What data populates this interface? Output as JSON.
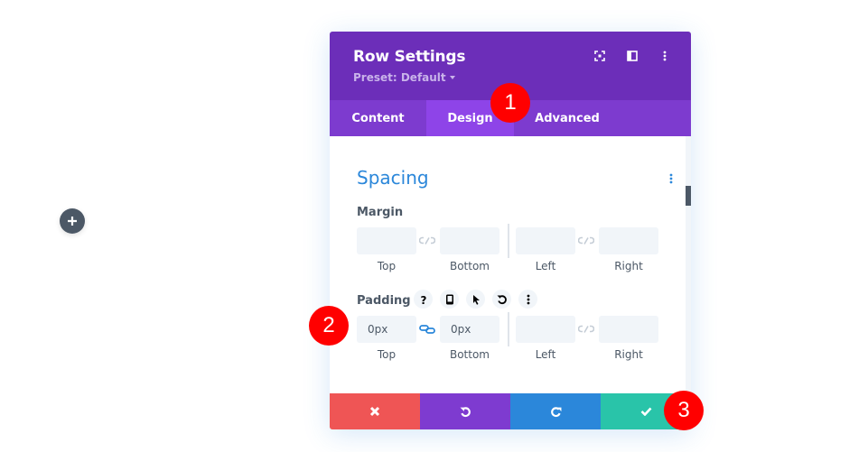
{
  "canvas": {
    "add_button_icon": "plus-icon"
  },
  "modal": {
    "title": "Row Settings",
    "preset_label": "Preset: Default",
    "header_icons": [
      "fullscreen-icon",
      "sidebar-toggle-icon",
      "more-vertical-icon"
    ],
    "tabs": [
      {
        "label": "Content",
        "active": false
      },
      {
        "label": "Design",
        "active": true
      },
      {
        "label": "Advanced",
        "active": false
      }
    ],
    "section": {
      "title": "Spacing",
      "margin": {
        "label": "Margin",
        "top": {
          "value": "",
          "label": "Top"
        },
        "bottom": {
          "value": "",
          "label": "Bottom"
        },
        "left": {
          "value": "",
          "label": "Left"
        },
        "right": {
          "value": "",
          "label": "Right"
        },
        "linked_vertical": false,
        "linked_horizontal": false
      },
      "padding": {
        "label": "Padding",
        "option_icons": [
          "help-icon",
          "mobile-icon",
          "cursor-icon",
          "reset-icon",
          "more-vertical-icon"
        ],
        "top": {
          "value": "0px",
          "label": "Top"
        },
        "bottom": {
          "value": "0px",
          "label": "Bottom"
        },
        "left": {
          "value": "",
          "label": "Left"
        },
        "right": {
          "value": "",
          "label": "Right"
        },
        "linked_vertical": true,
        "linked_horizontal": false
      }
    },
    "footer": {
      "cancel_icon": "close-icon",
      "undo_icon": "undo-icon",
      "redo_icon": "redo-icon",
      "save_icon": "checkmark-icon"
    }
  },
  "annotations": [
    {
      "number": "1"
    },
    {
      "number": "2"
    },
    {
      "number": "3"
    }
  ],
  "colors": {
    "header": "#6c2eb9",
    "tabs": "#7d3bcf",
    "active_tab": "#8e44e8",
    "accent_blue": "#2b87da",
    "cancel": "#ef5555",
    "undo": "#7e3bd0",
    "redo": "#2b87da",
    "save": "#29c4a9",
    "badge": "#ff0000"
  }
}
